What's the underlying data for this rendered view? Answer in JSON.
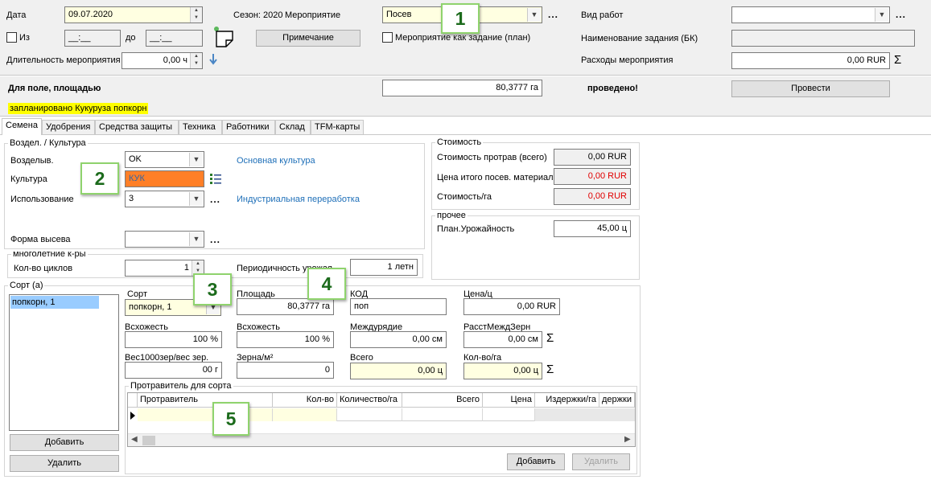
{
  "header": {
    "date_label": "Дата",
    "date_value": "09.07.2020",
    "season_text": "Сезон: 2020",
    "event_label": "Мероприятие",
    "event_value": "Посев",
    "work_type_label": "Вид работ",
    "work_type_value": "",
    "from_label": "Из",
    "from_value": "__:__",
    "to_label": "до",
    "to_value": "__:__",
    "note_button": "Примечание",
    "event_as_task_label": "Мероприятие как задание (план)",
    "task_name_label": "Наименование задания (БК)",
    "task_name_value": "",
    "duration_label": "Длительность мероприятия",
    "duration_value": "0,00 ч",
    "expenses_label": "Расходы мероприятия",
    "expenses_value": "0,00 RUR"
  },
  "status_bar": {
    "field_label": "Для поле, площадью",
    "area_value": "80,3777 га",
    "done_text": "проведено!",
    "conduct_button": "Провести",
    "planned_text": "запланировано Кукуруза попкорн"
  },
  "tabs": [
    "Семена",
    "Удобрения",
    "Средства защиты",
    "Техника",
    "Работники",
    "Склад",
    "TFM-карты"
  ],
  "culture": {
    "group_title": "Воздел. / Культура",
    "cultivated_label": "Возделыв.",
    "cultivated_value": "OK",
    "main_culture_link": "Основная культура",
    "culture_label": "Культура",
    "culture_value": "КУК",
    "usage_label": "Использование",
    "usage_value": "3",
    "industrial_link": "Индустриальная переработка",
    "sowing_form_label": "Форма высева",
    "sowing_form_value": ""
  },
  "perennial": {
    "group_title": "многолетние к-ры",
    "cycles_label": "Кол-во циклов",
    "cycles_value": "1",
    "periodicity_label": "Периодичность урожая",
    "periodicity_value": "1 летн"
  },
  "cost": {
    "group_title": "Стоимость",
    "treatment_cost_label": "Стоимость протрав (всего)",
    "treatment_cost_value": "0,00 RUR",
    "total_price_label": "Цена итого посев. материал",
    "total_price_value": "0,00 RUR",
    "cost_per_ha_label": "Стоимость/га",
    "cost_per_ha_value": "0,00 RUR"
  },
  "other": {
    "group_title": "прочее",
    "yield_label": "План.Урожайность",
    "yield_value": "45,00 ц"
  },
  "variety": {
    "group_title": "Сорт (а)",
    "list": [
      "попкорн, 1"
    ],
    "add_button": "Добавить",
    "delete_button": "Удалить",
    "sort_label": "Сорт",
    "sort_value": "попкорн, 1",
    "area_label": "Площадь",
    "area_value": "80,3777 га",
    "code_label": "КОД",
    "code_value": "поп",
    "price_label": "Цена/ц",
    "price_value": "0,00 RUR",
    "germination1_label": "Всхожесть",
    "germination1_value": "100 %",
    "germination2_label": "Всхожесть",
    "germination2_value": "100 %",
    "row_spacing_label": "Междурядие",
    "row_spacing_value": "0,00 см",
    "grain_spacing_label": "РасстМеждЗерн",
    "grain_spacing_value": "0,00 см",
    "weight_label": "Вес1000зер/вес зер.",
    "weight_value": "00 г",
    "grains_label": "Зерна/м²",
    "grains_value": "0",
    "total_label": "Всего",
    "total_value": "0,00 ц",
    "qty_per_ha_label": "Кол-во/га",
    "qty_per_ha_value": "0,00 ц"
  },
  "treatment": {
    "group_title": "Протравитель для сорта",
    "columns": [
      "Протравитель",
      "Кол-во",
      "Количество/га",
      "Всего",
      "Цена",
      "Издержки/га",
      "держки"
    ],
    "add_button": "Добавить",
    "delete_button": "Удалить"
  },
  "badges": [
    "1",
    "2",
    "3",
    "4",
    "5"
  ]
}
